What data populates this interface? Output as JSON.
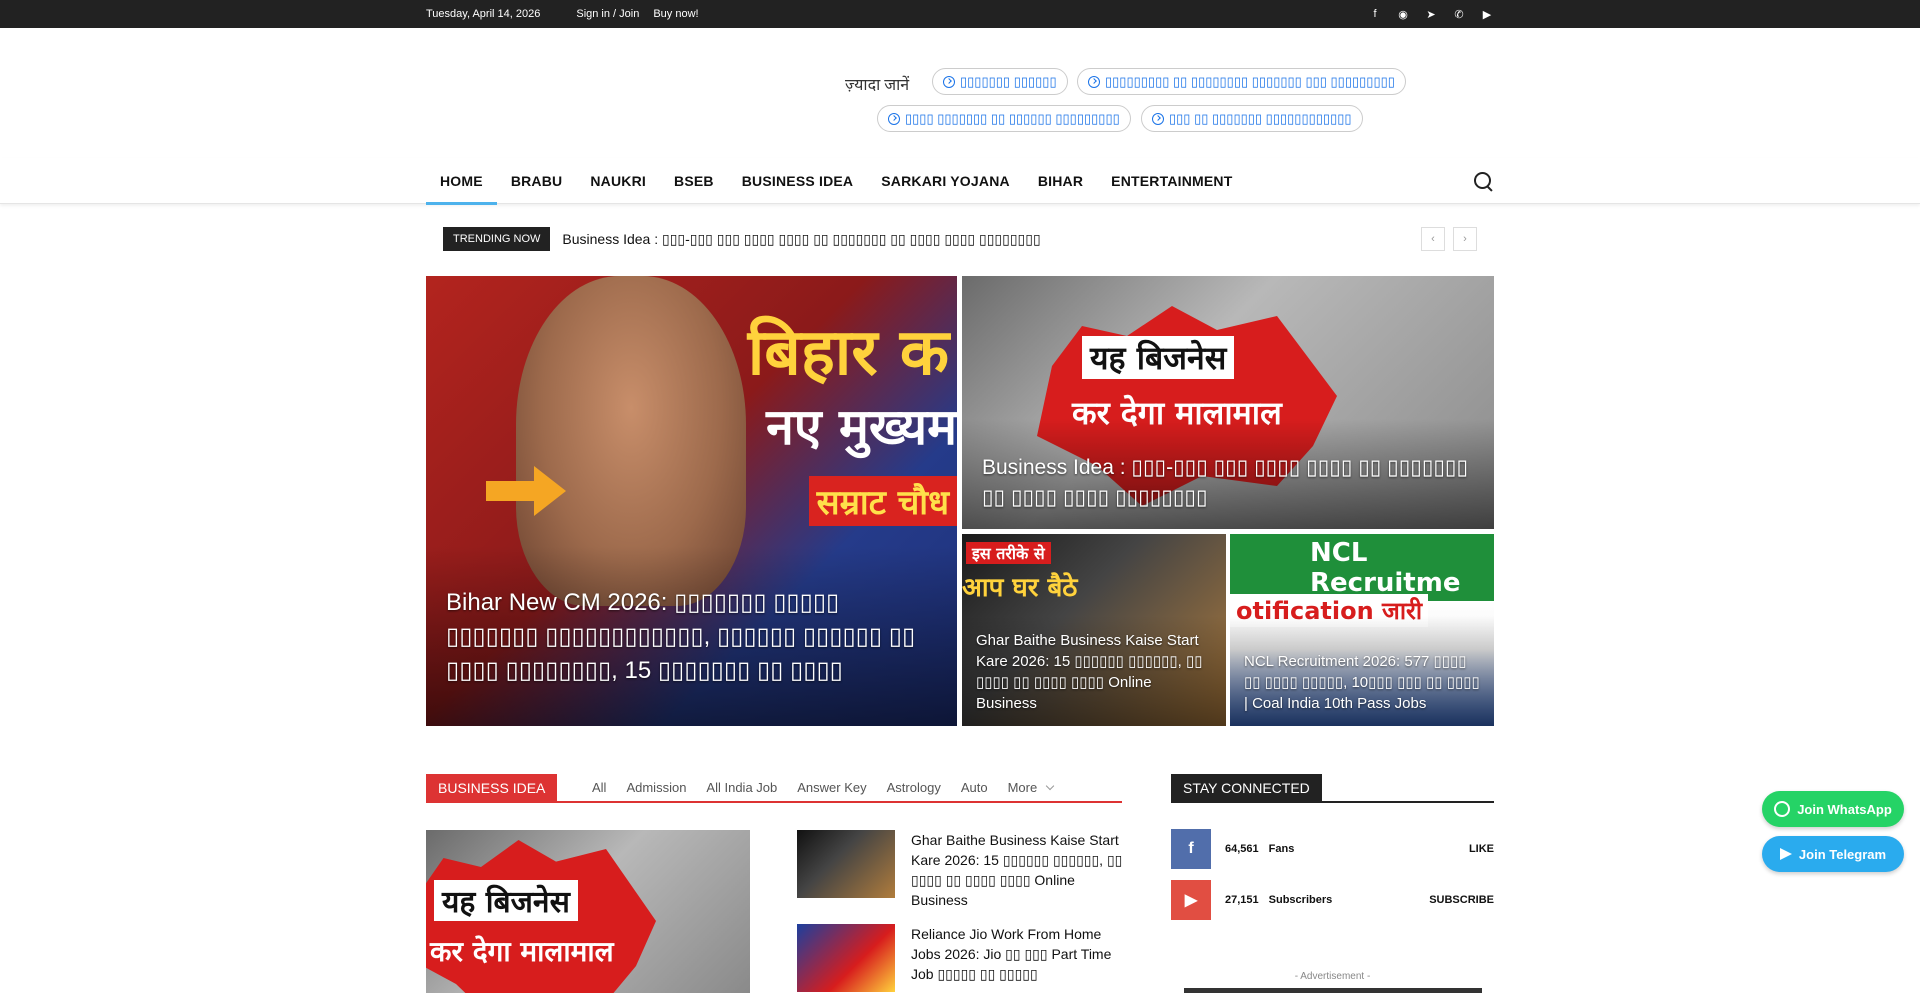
{
  "topbar": {
    "date": "Tuesday, April 14, 2026",
    "sign_in": "Sign in / Join",
    "buy_now": "Buy now!",
    "socials": [
      "facebook-icon",
      "rss-icon",
      "telegram-icon",
      "whatsapp-icon",
      "youtube-icon"
    ]
  },
  "header": {
    "more_label": "ज़्यादा जानें",
    "pills": [
      "▯▯▯▯▯▯▯ ▯▯▯▯▯▯",
      "▯▯▯▯▯▯▯▯▯ ▯▯ ▯▯▯▯▯▯▯▯ ▯▯▯▯▯▯▯ ▯▯▯ ▯▯▯▯▯▯▯▯▯",
      "▯▯▯▯ ▯▯▯▯▯▯▯ ▯▯ ▯▯▯▯▯▯ ▯▯▯▯▯▯▯▯▯",
      "▯▯▯ ▯▯ ▯▯▯▯▯▯▯ ▯▯▯▯▯▯▯▯▯▯▯▯"
    ]
  },
  "nav": {
    "items": [
      "HOME",
      "BRABU",
      "NAUKRI",
      "BSEB",
      "BUSINESS IDEA",
      "SARKARI YOJANA",
      "BIHAR",
      "ENTERTAINMENT"
    ],
    "active": "HOME"
  },
  "trending": {
    "label": "TRENDING NOW",
    "title": "Business Idea : ▯▯▯-▯▯▯ ▯▯▯ ▯▯▯▯ ▯▯▯▯ ▯▯ ▯▯▯▯▯▯▯ ▯▯ ▯▯▯▯ ▯▯▯▯ ▯▯▯▯▯▯▯▯"
  },
  "grid": {
    "main": {
      "caption": "Bihar New CM 2026: ▯▯▯▯▯▯▯ ▯▯▯▯▯ ▯▯▯▯▯▯▯ ▯▯▯▯▯▯▯▯▯▯▯▯, ▯▯▯▯▯▯ ▯▯▯▯▯▯ ▯▯ ▯▯▯▯ ▯▯▯▯▯▯▯▯, 15 ▯▯▯▯▯▯▯ ▯▯ ▯▯▯▯",
      "img_text": [
        "बिहार क",
        "नए मुख्यम",
        "सम्राट चौध"
      ]
    },
    "top_right": {
      "caption": "Business Idea : ▯▯▯-▯▯▯ ▯▯▯ ▯▯▯▯ ▯▯▯▯ ▯▯ ▯▯▯▯▯▯▯ ▯▯ ▯▯▯▯ ▯▯▯▯ ▯▯▯▯▯▯▯▯",
      "img_text": [
        "यह बिजनेस",
        "कर देगा मालामाल"
      ]
    },
    "bottom_left": {
      "caption": "Ghar Baithe Business Kaise Start Kare 2026: 15 ▯▯▯▯▯▯ ▯▯▯▯▯▯, ▯▯ ▯▯▯▯ ▯▯ ▯▯▯▯ ▯▯▯▯ Online Business",
      "img_text": [
        "इस तरीके से",
        "आप घर बैठे"
      ]
    },
    "bottom_right": {
      "caption": "NCL Recruitment 2026: 577 ▯▯▯▯ ▯▯ ▯▯▯▯ ▯▯▯▯▯, 10▯▯▯ ▯▯▯ ▯▯ ▯▯▯▯ | Coal India 10th Pass Jobs",
      "img_text": [
        "NCL Recruitme",
        "otification जारी"
      ]
    }
  },
  "section": {
    "label": "BUSINESS IDEA",
    "tabs": [
      "All",
      "Admission",
      "All India Job",
      "Answer Key",
      "Astrology",
      "Auto",
      "More"
    ],
    "main_thumb_text": [
      "यह बिजनेस",
      "कर देगा मालामाल"
    ],
    "list": [
      "Ghar Baithe Business Kaise Start Kare 2026: 15 ▯▯▯▯▯▯ ▯▯▯▯▯▯, ▯▯ ▯▯▯▯ ▯▯ ▯▯▯▯ ▯▯▯▯ Online Business",
      "Reliance Jio Work From Home Jobs 2026: Jio ▯▯ ▯▯▯ Part Time Job ▯▯▯▯▯ ▯▯ ▯▯▯▯▯"
    ]
  },
  "stay": {
    "label": "STAY CONNECTED",
    "fb": {
      "count": "64,561",
      "unit": "Fans",
      "action": "LIKE"
    },
    "yt": {
      "count": "27,151",
      "unit": "Subscribers",
      "action": "SUBSCRIBE"
    },
    "ad_label": "- Advertisement -"
  },
  "floating": {
    "whatsapp": "Join WhatsApp",
    "telegram": "Join Telegram"
  }
}
